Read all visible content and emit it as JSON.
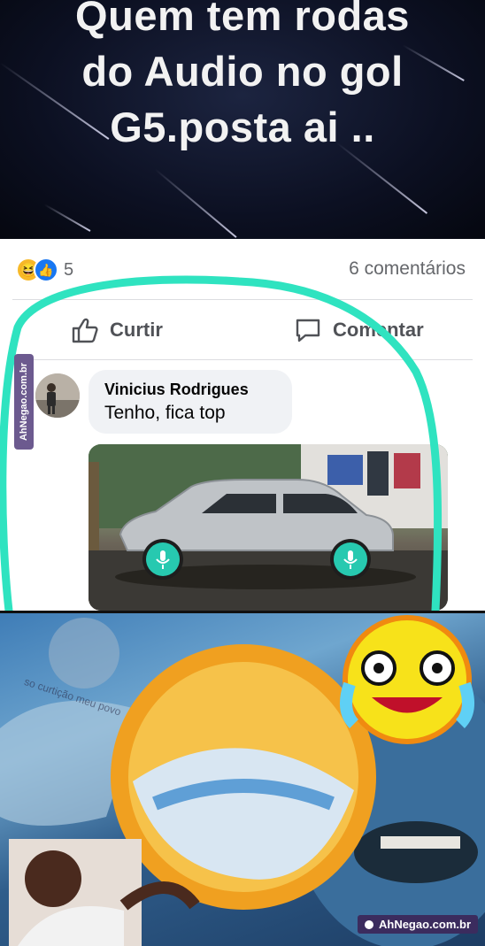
{
  "banner": {
    "text": "Quem tem rodas\ndo Audio no gol\nG5.posta ai .."
  },
  "post": {
    "reaction_count": "5",
    "comments_count": "6 comentários",
    "actions": {
      "like_label": "Curtir",
      "comment_label": "Comentar"
    },
    "comment": {
      "author": "Vinicius Rodrigues",
      "text": "Tenho, fica top"
    }
  },
  "watermarks": {
    "side": "AhNegao.com.br",
    "bottom": "AhNegao.com.br"
  },
  "meme": {
    "caption": "so curtição meu povo"
  },
  "colors": {
    "highlight_loop": "#2fe3c0",
    "fb_blue": "#1877f2",
    "wheel_color": "#27c9b0"
  }
}
